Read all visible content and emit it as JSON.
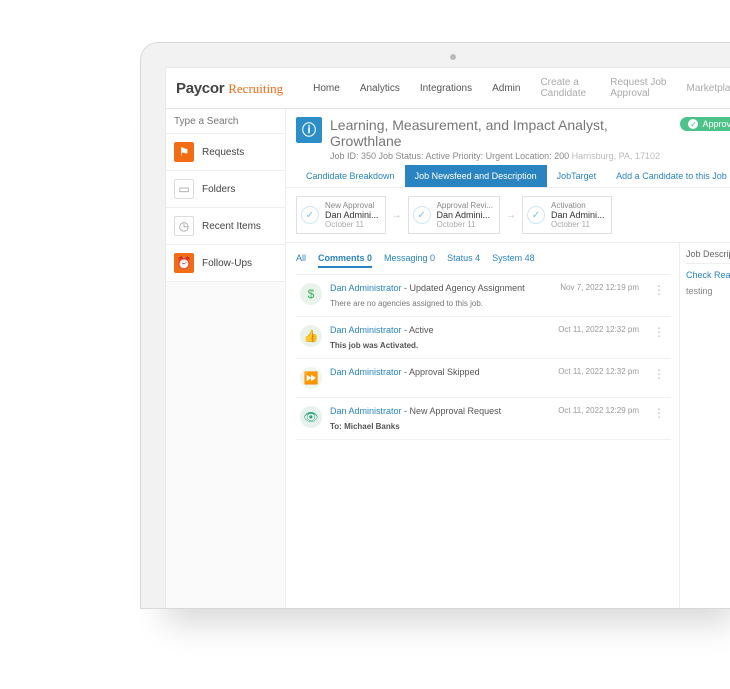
{
  "brand": {
    "main": "Paycor",
    "sub": "Recruiting"
  },
  "nav": {
    "home": "Home",
    "analytics": "Analytics",
    "integrations": "Integrations",
    "admin": "Admin",
    "create_candidate": "Create a Candidate",
    "request_job_approval": "Request Job Approval",
    "marketplace": "Marketplace"
  },
  "search": {
    "placeholder": "Type a Search"
  },
  "sidebar": {
    "requests": "Requests",
    "folders": "Folders",
    "recent": "Recent Items",
    "followups": "Follow-Ups"
  },
  "job": {
    "title": "Learning, Measurement, and Impact Analyst, Growthlane",
    "meta_prefix": "Job ID: 350  Job Status: Active  Priority: Urgent  Location: 200",
    "meta_city": " Harrisburg, PA, 17102",
    "approved_label": "Approved"
  },
  "subtabs": {
    "breakdown": "Candidate Breakdown",
    "newsfeed": "Job Newsfeed and Description",
    "jobtarget": "JobTarget",
    "add_candidate": "Add a Candidate to this Job"
  },
  "chain": [
    {
      "kind": "New Approval",
      "who": "Dan Admini...",
      "date": "October 11"
    },
    {
      "kind": "Approval Revi...",
      "who": "Dan Admini...",
      "date": "October 11"
    },
    {
      "kind": "Activation",
      "who": "Dan Admini...",
      "date": "October 11"
    }
  ],
  "filters": {
    "all": "All",
    "comments": "Comments 0",
    "messaging": "Messaging 0",
    "status": "Status 4",
    "system": "System 48"
  },
  "feed": [
    {
      "who": "Dan Administrator",
      "action": " - Updated Agency Assignment",
      "ts": "Nov 7, 2022 12:19 pm",
      "sub": "There are no agencies assigned to this job.",
      "sub_bold": false
    },
    {
      "who": "Dan Administrator",
      "action": " - Active",
      "ts": "Oct 11, 2022 12:32 pm",
      "sub": "This job was Activated.",
      "sub_bold": true
    },
    {
      "who": "Dan Administrator",
      "action": " - Approval Skipped",
      "ts": "Oct 11, 2022 12:32 pm",
      "sub": "",
      "sub_bold": false
    },
    {
      "who": "Dan Administrator",
      "action": " - New Approval Request",
      "ts": "Oct 11, 2022 12:29 pm",
      "sub": "To: Michael Banks",
      "sub_bold": true
    }
  ],
  "right": {
    "header": "Job Descriptio",
    "check_link": "Check Readab",
    "body": "testing"
  }
}
